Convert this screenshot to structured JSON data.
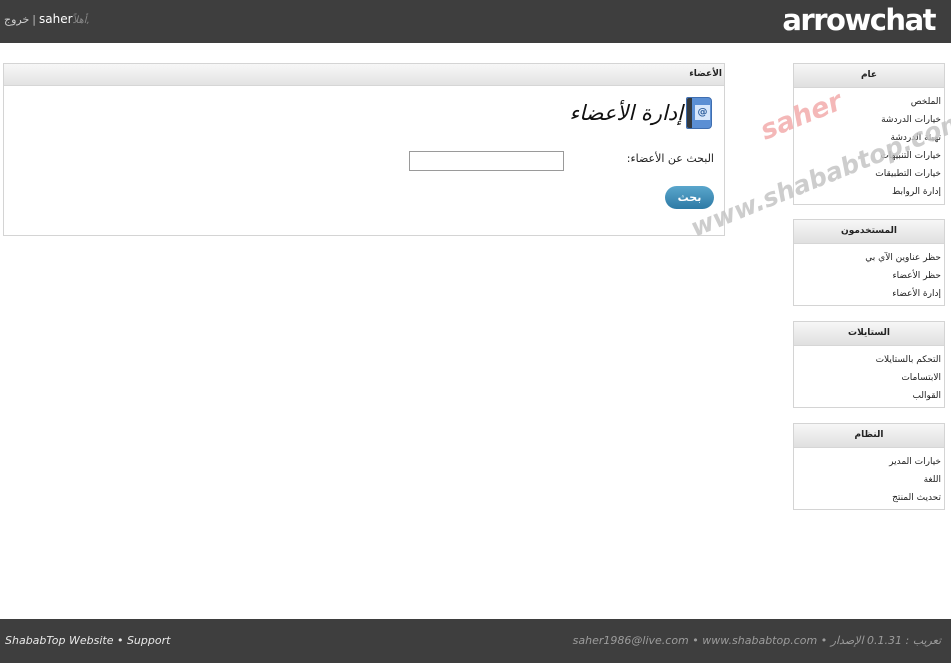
{
  "header": {
    "logo": "arrowchat",
    "user_nav": {
      "logout": "خروج",
      "separator": "|",
      "username": "saher",
      "greeting": "أهلاً,"
    }
  },
  "main": {
    "panel_title": "الأعضاء",
    "page_title": "إدارة الأعضاء",
    "search_label": "البحث عن الأعضاء:",
    "search_value": "",
    "search_button": "بحث"
  },
  "sidebar": [
    {
      "title": "عام",
      "items": [
        "الملخص",
        "خيارات الدردشة",
        "تهيئة الدردشة",
        "خيارات التنبيهات",
        "خيارات التطبيقات",
        "إدارة الروابط"
      ]
    },
    {
      "title": "المستخدمون",
      "items": [
        "حظر عناوين الآي بي",
        "حظر الأعضاء",
        "إدارة الأعضاء"
      ]
    },
    {
      "title": "الستايلات",
      "items": [
        "التحكم بالستايلات",
        "الابتسامات",
        "القوالب"
      ]
    },
    {
      "title": "النظام",
      "items": [
        "خيارات المدير",
        "اللغة",
        "تحديث المنتج"
      ]
    }
  ],
  "watermark": {
    "name": "saher",
    "site": "www.shababtop.com"
  },
  "footer": {
    "left": "ShababTop Website • Support",
    "right": "saher1986@live.com • www.shababtop.com • تعريب : 0.1.31 الإصدار"
  },
  "colors": {
    "bar": "#3e3e3e",
    "button": "#2d7aa5",
    "watermark_name": "#f0a0a0",
    "watermark_site": "#c4c4c4"
  }
}
